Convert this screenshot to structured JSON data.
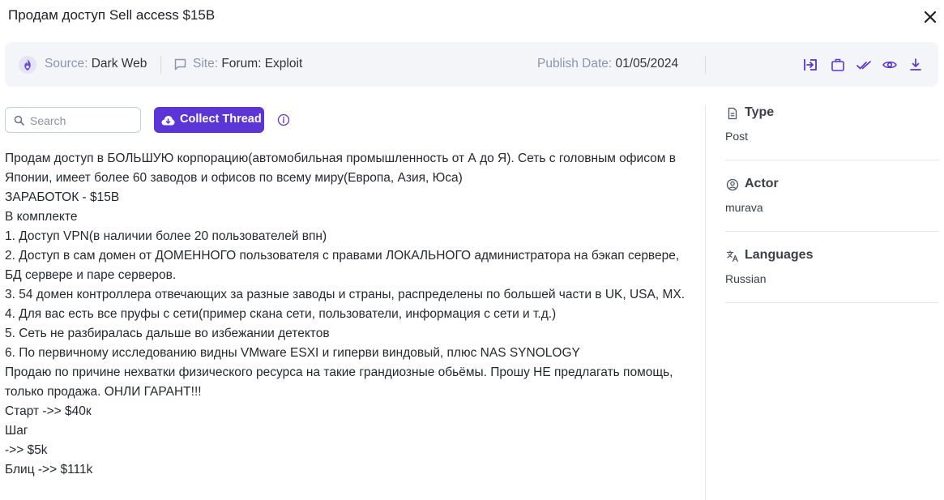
{
  "header": {
    "title": "Продам доступ Sell access $15B"
  },
  "infobar": {
    "source_label": "Source:",
    "source_value": "Dark Web",
    "site_label": "Site:",
    "site_value": "Forum: Exploit",
    "publish_label": "Publish Date:",
    "publish_value": "01/05/2024",
    "actions": [
      "sign-in-icon",
      "briefcase-icon",
      "double-check-icon",
      "eye-icon",
      "download-icon"
    ]
  },
  "toolbar": {
    "search_placeholder": "Search",
    "collect_label": "Collect Thread"
  },
  "post": {
    "lines": [
      "Продам доступ в БОЛЬШУЮ корпорацию(автомобильная промышленность от А до Я). Сеть с головным офисом в Японии, имеет более 60 заводов и офисов по всему миру(Европа, Азия, Юса)",
      "ЗАРАБОТОК - $15B",
      "В комплекте",
      "1. Доступ VPN(в наличии более 20 пользователей впн)",
      "2. Доступ в сам домен от ДОМЕННОГО пользователя с правами ЛОКАЛЬНОГО администратора на бэкап сервере, БД сервере и паре серверов.",
      "3. 54 домен контроллера отвечающих за разные заводы и страны, распределены по большей части в UK, USA, MX.",
      "4. Для вас есть все пруфы с сети(пример скана сети, пользователи, информация с сети и т.д.)",
      "5. Сеть не разбиралась дальше во избежании детектов",
      "6. По первичному исследованию видны VMware ESXI и гиперви виндовый, плюс NAS SYNOLOGY",
      "Продаю по причине нехватки физического ресурса на такие грандиозные обьёмы. Прошу НЕ предлагать помощь, только продажа. ОНЛИ ГАРАНТ!!!",
      "Старт ->> $40к",
      "Шаг",
      "->> $5k",
      "Блиц  ->> $111k"
    ]
  },
  "sidebar": {
    "type_label": "Type",
    "type_value": "Post",
    "actor_label": "Actor",
    "actor_value": "murava",
    "languages_label": "Languages",
    "languages_value": "Russian"
  },
  "colors": {
    "accent": "#5b35d6",
    "infobar_bg": "#f4f5f9",
    "label_gray": "#8a96ad",
    "icon_accent": "#5b35d6"
  }
}
